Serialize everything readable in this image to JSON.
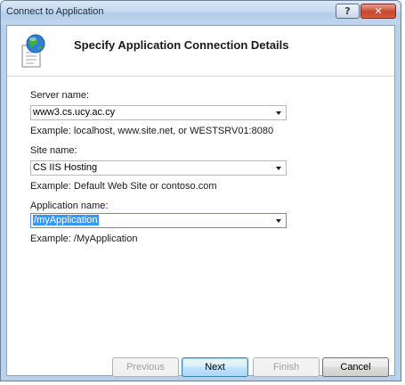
{
  "window": {
    "title": "Connect to Application",
    "help_glyph": "?",
    "close_glyph": "✕"
  },
  "header": {
    "title": "Specify Application Connection Details",
    "icon": "globe-document-icon"
  },
  "form": {
    "server_label": "Server name:",
    "server_value": "www3.cs.ucy.ac.cy",
    "server_example": "Example: localhost, www.site.net, or WESTSRV01:8080",
    "site_label": "Site name:",
    "site_value": "CS IIS Hosting",
    "site_example": "Example: Default Web Site or contoso.com",
    "app_label": "Application name:",
    "app_value": "/myApplication",
    "app_example": "Example: /MyApplication"
  },
  "buttons": {
    "previous": "Previous",
    "next": "Next",
    "finish": "Finish",
    "cancel": "Cancel"
  },
  "colors": {
    "selection": "#3399ff",
    "close_button": "#c8452c",
    "title_bar": "#c6d9ef"
  }
}
